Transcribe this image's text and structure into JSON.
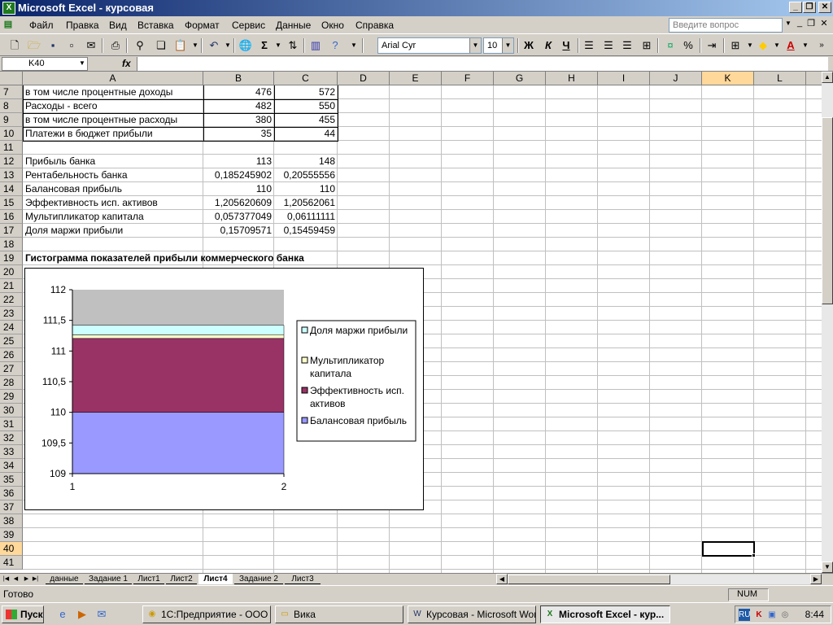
{
  "window": {
    "title": "Microsoft Excel - курсовая",
    "app_icon": "X"
  },
  "menu": {
    "items": [
      "Файл",
      "Правка",
      "Вид",
      "Вставка",
      "Формат",
      "Сервис",
      "Данные",
      "Окно",
      "Справка"
    ],
    "ask_placeholder": "Введите вопрос"
  },
  "toolbar": {
    "font": "Arial Cyr",
    "size": "10",
    "bold": "Ж",
    "italic": "К",
    "underline": "Ч",
    "sum": "Σ",
    "percent": "%"
  },
  "formula_bar": {
    "name_box": "K40",
    "fx": "fx",
    "value": ""
  },
  "columns": [
    "A",
    "B",
    "C",
    "D",
    "E",
    "F",
    "G",
    "H",
    "I",
    "J",
    "K",
    "L"
  ],
  "rows": [
    "7",
    "8",
    "9",
    "10",
    "11",
    "12",
    "13",
    "14",
    "15",
    "16",
    "17",
    "18",
    "19",
    "20",
    "21",
    "22",
    "23",
    "24",
    "25",
    "26",
    "27",
    "28",
    "29",
    "30",
    "31",
    "32",
    "33",
    "34",
    "35",
    "36",
    "37",
    "38",
    "39",
    "40",
    "41"
  ],
  "cells": {
    "r7": {
      "a": "в том числе процентные доходы",
      "b": "476",
      "c": "572"
    },
    "r8": {
      "a": "Расходы - всего",
      "b": "482",
      "c": "550"
    },
    "r9": {
      "a": "в том числе процентные расходы",
      "b": "380",
      "c": "455"
    },
    "r10": {
      "a": "Платежи в бюджет прибыли",
      "b": "35",
      "c": "44"
    },
    "r12": {
      "a": "Прибыль банка",
      "b": "113",
      "c": "148"
    },
    "r13": {
      "a": "Рентабельность банка",
      "b": "0,185245902",
      "c": "0,20555556"
    },
    "r14": {
      "a": "Балансовая прибыль",
      "b": "110",
      "c": "110"
    },
    "r15": {
      "a": "Эффективность исп. активов",
      "b": "1,205620609",
      "c": "1,20562061"
    },
    "r16": {
      "a": "Мультипликатор капитала",
      "b": "0,057377049",
      "c": "0,06111111"
    },
    "r17": {
      "a": "Доля маржи прибыли",
      "b": "0,15709571",
      "c": "0,15459459"
    },
    "r19": {
      "a": "Гистограмма показателей прибыли коммерческого банка"
    }
  },
  "chart_data": {
    "type": "area",
    "stacked": true,
    "x": [
      "1",
      "2"
    ],
    "ylim": [
      109,
      112
    ],
    "yticks": [
      "112",
      "111,5",
      "111",
      "110,5",
      "110",
      "109,5",
      "109"
    ],
    "series": [
      {
        "name": "Балансовая прибыль",
        "values": [
          110,
          110
        ],
        "color": "#9999ff"
      },
      {
        "name": "Эффективность исп. активов",
        "values": [
          1.205620609,
          1.20562061
        ],
        "color": "#993366"
      },
      {
        "name": "Мультипликатор капитала",
        "values": [
          0.057377049,
          0.06111111
        ],
        "color": "#ffffcc"
      },
      {
        "name": "Доля маржи прибыли",
        "values": [
          0.15709571,
          0.15459459
        ],
        "color": "#ccffff"
      }
    ],
    "legend_order": [
      "Доля маржи прибыли",
      "Мультипликатор капитала",
      "Эффективность исп. активов",
      "Балансовая прибыль"
    ],
    "legend_position": "right",
    "plot_background": "#c0c0c0",
    "grid": false
  },
  "sheets": [
    "данные",
    "Задание 1",
    "Лист1",
    "Лист2",
    "Лист4",
    "Задание 2",
    "Лист3"
  ],
  "active_sheet": "Лист4",
  "status": {
    "text": "Готово",
    "num": "NUM"
  },
  "taskbar": {
    "start": "Пуск",
    "tasks": [
      "1С:Предприятие - ООО ...",
      "Вика",
      "Курсовая - Microsoft Word",
      "Microsoft Excel - кур..."
    ],
    "lang": "RU",
    "clock": "8:44"
  }
}
